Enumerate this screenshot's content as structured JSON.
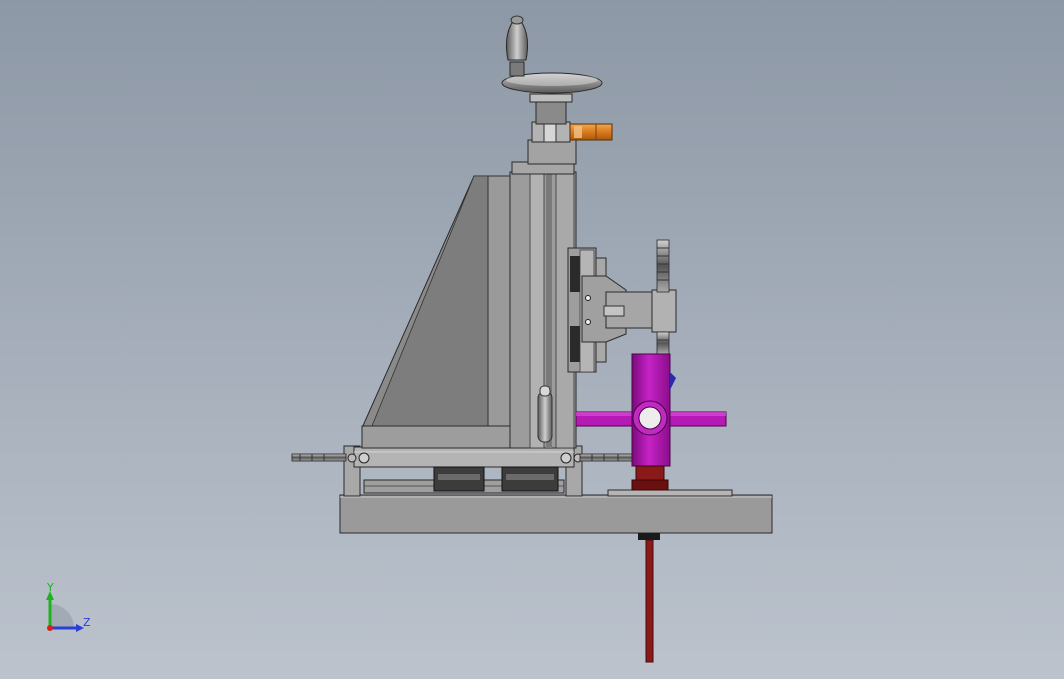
{
  "viewport": {
    "background_top": "#8d98a6",
    "background_bottom": "#bcc3cd"
  },
  "triad": {
    "y_label": "Y",
    "z_label": "Z",
    "y_color": "#1fb21f",
    "z_color": "#2a3fd6",
    "x_color": "#d42020"
  },
  "model": {
    "body_color": "#8c8c8c",
    "clamp_color": "#b010b0",
    "collet_color": "#8a1a1a",
    "lever_color": "#e08a28"
  }
}
